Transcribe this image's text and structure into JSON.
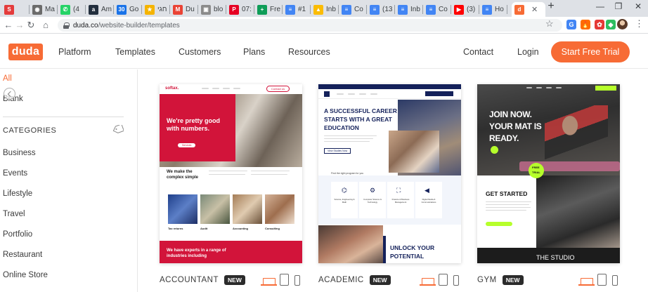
{
  "browser": {
    "tabs": [
      {
        "label": "",
        "favicon_text": "S",
        "favicon_color": "#e43c3c"
      },
      {
        "label": "Ma",
        "favicon_text": "◉",
        "favicon_color": "#6b6b6b"
      },
      {
        "label": "(4",
        "favicon_text": "✆",
        "favicon_color": "#25d366"
      },
      {
        "label": "Am",
        "favicon_text": "a",
        "favicon_color": "#232f3e"
      },
      {
        "label": "Go",
        "favicon_text": "30",
        "favicon_color": "#1a73e8"
      },
      {
        "label": "חגי",
        "favicon_text": "★",
        "favicon_color": "#f5b400"
      },
      {
        "label": "Du",
        "favicon_text": "M",
        "favicon_color": "#ea4335"
      },
      {
        "label": "blo",
        "favicon_text": "▣",
        "favicon_color": "#8b8b8b"
      },
      {
        "label": "07:",
        "favicon_text": "P",
        "favicon_color": "#e60023"
      },
      {
        "label": "Fre",
        "favicon_text": "+",
        "favicon_color": "#0f9d58"
      },
      {
        "label": "#1",
        "favicon_text": "≡",
        "favicon_color": "#4285f4"
      },
      {
        "label": "Inb",
        "favicon_text": "▲",
        "favicon_color": "#fbbc04"
      },
      {
        "label": "Co",
        "favicon_text": "≡",
        "favicon_color": "#4285f4"
      },
      {
        "label": "(13",
        "favicon_text": "≡",
        "favicon_color": "#4285f4"
      },
      {
        "label": "Inb",
        "favicon_text": "≡",
        "favicon_color": "#4285f4"
      },
      {
        "label": "Co",
        "favicon_text": "≡",
        "favicon_color": "#4285f4"
      },
      {
        "label": "(3)",
        "favicon_text": "▶",
        "favicon_color": "#ff0000"
      },
      {
        "label": "Ho",
        "favicon_text": "≡",
        "favicon_color": "#4285f4"
      }
    ],
    "active_tab": {
      "favicon_text": "d",
      "favicon_color": "#f76b35"
    },
    "new_tab": "+",
    "window_controls": {
      "minimize": "—",
      "restore": "❐",
      "close": "✕"
    },
    "back": "←",
    "forward": "→",
    "reload": "↻",
    "home": "⌂",
    "url_host": "duda.co",
    "url_path": "/website-builder/templates",
    "bookmark_star": "☆",
    "extensions": [
      {
        "text": "G",
        "color": "#4285f4"
      },
      {
        "text": "🔥",
        "color": "#ffffff"
      },
      {
        "text": "✿",
        "color": "#ffffff"
      },
      {
        "text": "◆",
        "color": "#2dbe60"
      }
    ],
    "menu": "⋮"
  },
  "header": {
    "logo": "duda",
    "nav": [
      "Platform",
      "Templates",
      "Customers",
      "Plans",
      "Resources"
    ],
    "contact": "Contact",
    "login": "Login",
    "cta": "Start Free Trial"
  },
  "sidebar": {
    "all": "All",
    "blank": "Blank",
    "categories_heading": "CATEGORIES",
    "categories": [
      "Business",
      "Events",
      "Lifestyle",
      "Travel",
      "Portfolio",
      "Restaurant",
      "Online Store"
    ]
  },
  "templates": [
    {
      "name": "ACCOUNTANT",
      "badge": "NEW",
      "preview": {
        "logo": "softax.",
        "button": "Contact us",
        "hero_title_1": "We're pretty good",
        "hero_title_2": "with numbers.",
        "hero_btn": "Services",
        "section_title_1": "We make the",
        "section_title_2": "complex simple",
        "services": [
          "Tax returns",
          "Audit",
          "Accounting",
          "Consulting"
        ],
        "band_title_1": "We have experts in a range of",
        "band_title_2": "industries including"
      }
    },
    {
      "name": "ACADEMIC",
      "badge": "NEW",
      "preview": {
        "hero_title_1": "A SUCCESSFUL CAREER",
        "hero_title_2": "STARTS WITH A GREAT",
        "hero_title_3": "EDUCATION",
        "hero_btn": "View Studies Now",
        "programs_heading": "Find the right program for you",
        "programs": [
          "Science, Engineering & Math",
          "Computer Science & Technology",
          "Finance & Business Management",
          "Digital Media & Communications"
        ],
        "bottom_title_1": "UNLOCK YOUR",
        "bottom_title_2": "POTENTIAL"
      }
    },
    {
      "name": "GYM",
      "badge": "NEW",
      "preview": {
        "hero_title_1": "JOIN NOW.",
        "hero_title_2": "YOUR MAT IS",
        "hero_title_3": "READY.",
        "badge_1": "FREE",
        "badge_2": "TRIAL",
        "get_started": "GET STARTED",
        "footer_title": "THE STUDIO"
      }
    }
  ],
  "colors": {
    "brand_orange": "#f76b35",
    "accountant_red": "#d2143a",
    "academic_navy": "#14215a",
    "gym_lime": "#b6ff2b"
  }
}
